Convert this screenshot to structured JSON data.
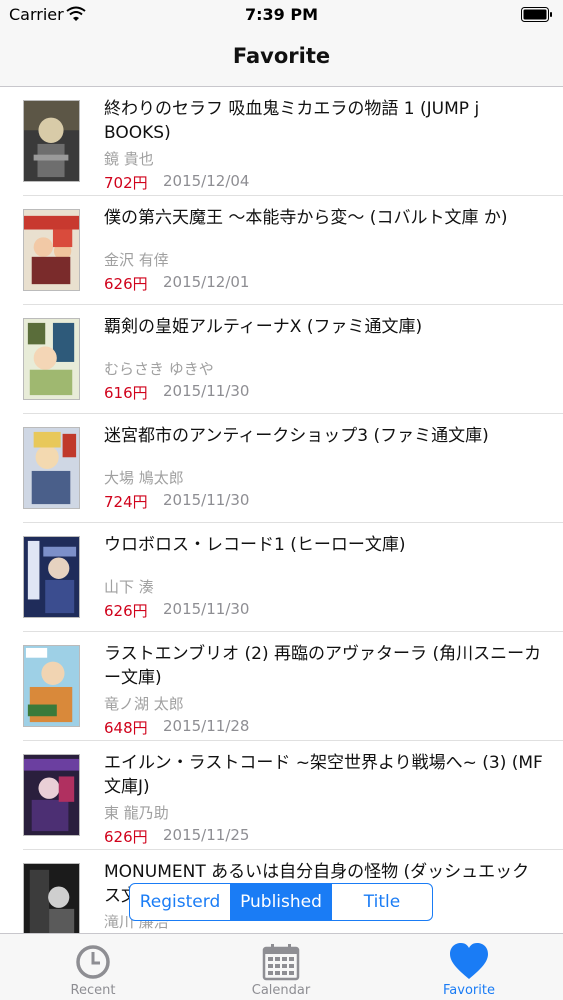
{
  "status_bar": {
    "carrier": "Carrier",
    "time": "7:39 PM"
  },
  "nav": {
    "title": "Favorite"
  },
  "books": [
    {
      "title": "終わりのセラフ 吸血鬼ミカエラの物語 1 (JUMP j BOOKS)",
      "author": "鏡 貴也",
      "price": "702円",
      "date": "2015/12/04"
    },
    {
      "title": "僕の第六天魔王 〜本能寺から変〜 (コバルト文庫 か)",
      "author": "金沢 有倖",
      "price": "626円",
      "date": "2015/12/01"
    },
    {
      "title": "覇剣の皇姫アルティーナX (ファミ通文庫)",
      "author": "むらさき ゆきや",
      "price": "616円",
      "date": "2015/11/30"
    },
    {
      "title": "迷宮都市のアンティークショップ3 (ファミ通文庫)",
      "author": "大場 鳩太郎",
      "price": "724円",
      "date": "2015/11/30"
    },
    {
      "title": "ウロボロス・レコード1 (ヒーロー文庫)",
      "author": "山下 湊",
      "price": "626円",
      "date": "2015/11/30"
    },
    {
      "title": "ラストエンブリオ (2) 再臨のアヴァターラ (角川スニーカー文庫)",
      "author": "竜ノ湖 太郎",
      "price": "648円",
      "date": "2015/11/28"
    },
    {
      "title": "エイルン・ラストコード ~架空世界より戦場へ~ (3) (MF文庫J)",
      "author": "東 龍乃助",
      "price": "626円",
      "date": "2015/11/25"
    },
    {
      "title": "MONUMENT あるいは自分自身の怪物 (ダッシュエックス文庫)",
      "author": "滝川 廉治",
      "price": "",
      "date": ""
    }
  ],
  "sort_control": {
    "registered": "Registerd",
    "published": "Published",
    "title": "Title"
  },
  "tabs": {
    "recent": "Recent",
    "calendar": "Calendar",
    "favorite": "Favorite"
  },
  "colors": {
    "accent": "#1a7cf5",
    "price": "#d0021b"
  },
  "icons": {
    "recent": "clock-icon",
    "calendar": "calendar-icon",
    "favorite": "heart-icon"
  }
}
